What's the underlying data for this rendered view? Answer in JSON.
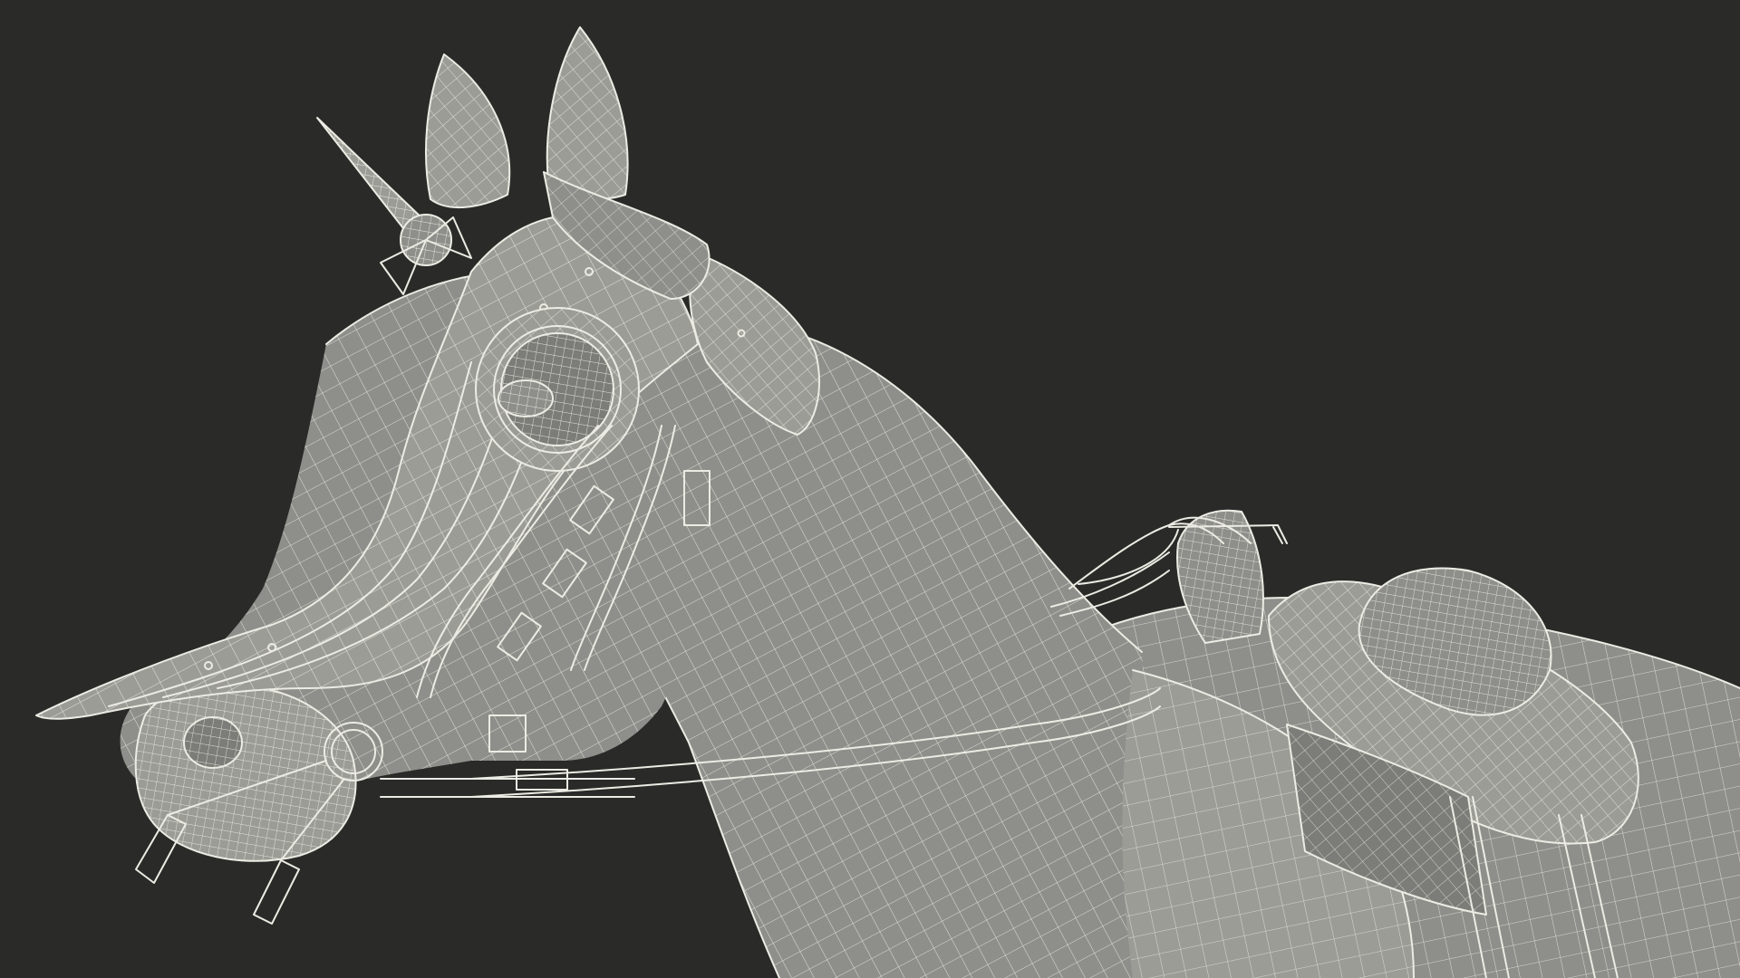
{
  "scene": {
    "subject": "armored-horse-wireframe",
    "background_color": "#2a2a28",
    "mesh_fill_color": "#8e8e8a",
    "wire_color": "#ecece4"
  }
}
